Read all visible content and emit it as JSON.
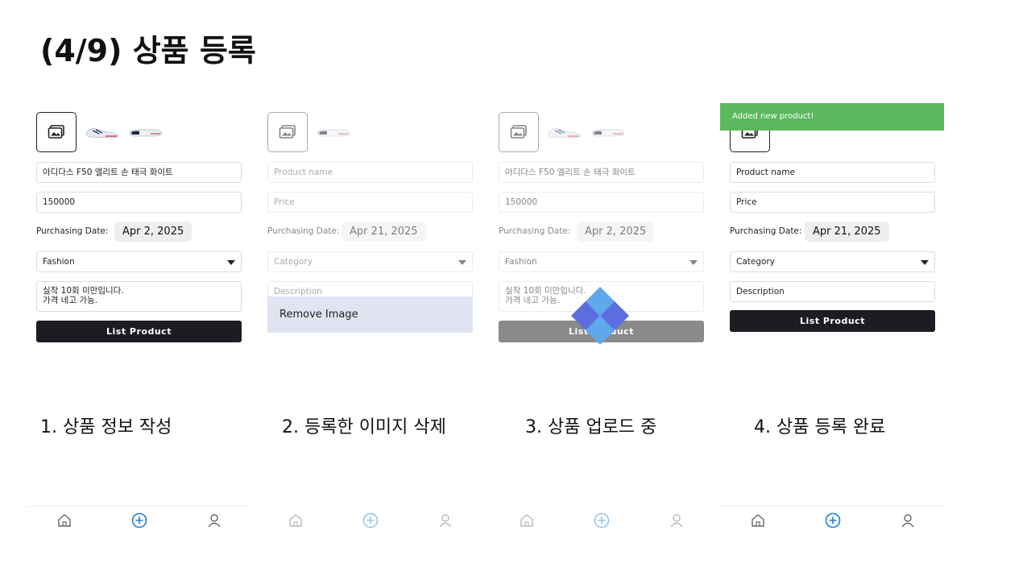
{
  "slide": {
    "title": "(4/9) 상품 등록"
  },
  "colors": {
    "toast": "#5cb85c",
    "primary_button": "#1c1d22",
    "accent": "#1a7fd4",
    "spinner_light": "#5fa8ec",
    "spinner_dark": "#5b6ee1"
  },
  "panels": [
    {
      "name_value": "아디다스 F50 엘리트 손 태극 화이트",
      "price_value": "150000",
      "date_label": "Purchasing Date:",
      "date_value": "Apr 2, 2025",
      "category_value": "Fashion",
      "description_line1": "실착 10회 미만입니다.",
      "description_line2": "가격 네고 가능.",
      "list_button": "List Product",
      "caption": "1. 상품 정보 작성"
    },
    {
      "name_placeholder": "Product name",
      "price_placeholder": "Price",
      "date_label": "Purchasing Date:",
      "date_value": "Apr 21, 2025",
      "category_placeholder": "Category",
      "description_placeholder": "Description",
      "remove_image": "Remove Image",
      "caption": "2. 등록한 이미지 삭제"
    },
    {
      "name_value": "아디다스 F50 엘리트 손 태극 화이트",
      "price_value": "150000",
      "date_label": "Purchasing Date:",
      "date_value": "Apr 2, 2025",
      "category_value": "Fashion",
      "description_line1": "실착 10회 미만입니다.",
      "description_line2": "가격 네고 가능.",
      "list_button": "List Product",
      "caption": "3. 상품 업로드 중"
    },
    {
      "toast": "Added new product!",
      "name_placeholder": "Product name",
      "price_placeholder": "Price",
      "date_label": "Purchasing Date:",
      "date_value": "Apr 21, 2025",
      "category_placeholder": "Category",
      "description_placeholder": "Description",
      "list_button": "List Product",
      "caption": "4. 상품 등록 완료"
    }
  ],
  "tabbar": {
    "icons": [
      "home-icon",
      "add-circle-icon",
      "profile-icon"
    ],
    "active": "add-circle-icon"
  }
}
